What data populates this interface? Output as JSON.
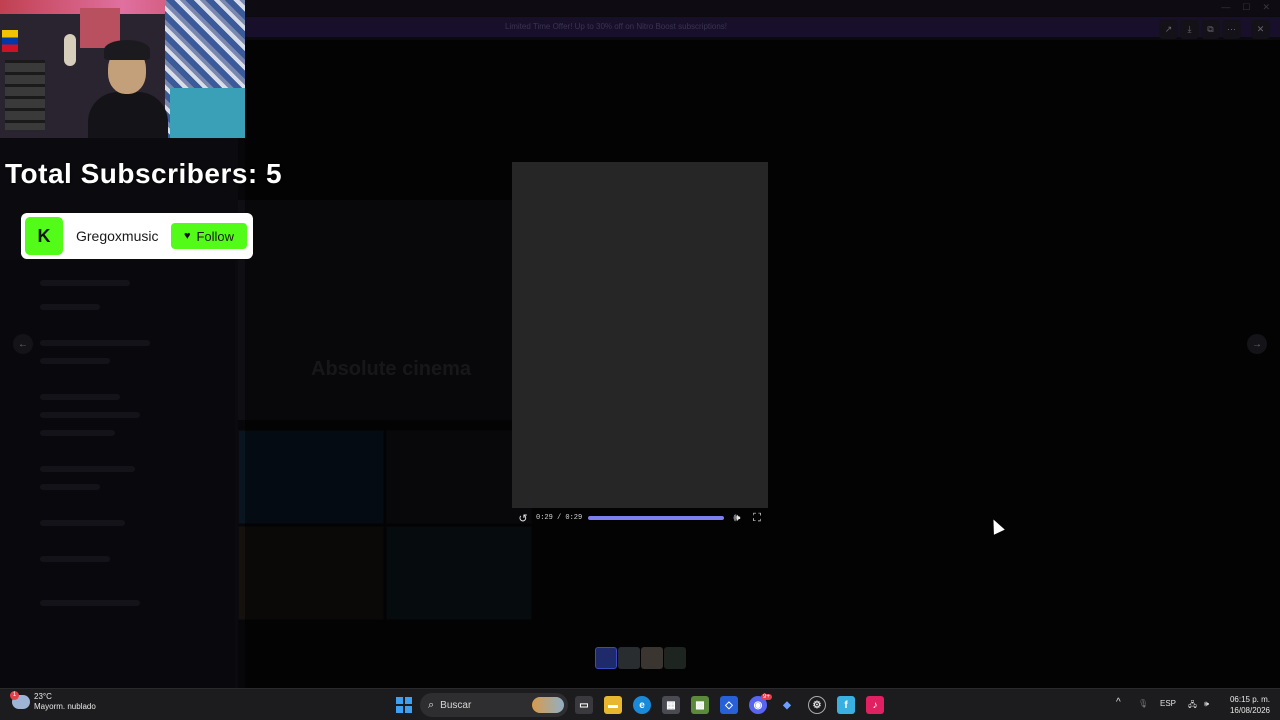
{
  "overlay": {
    "subscribers_label": "Total Subscribers: 5",
    "kick_card": {
      "logo_letter": "K",
      "channel": "Gregoxmusic",
      "follow_label": "Follow"
    }
  },
  "background": {
    "banner_text": "Limited Time Offer! Up to 30% off on Nitro Boost subscriptions!",
    "meme_text": "Absolute cinema"
  },
  "player": {
    "time": "0:29 / 0:29",
    "progress": 1.0,
    "colors": {
      "progress": "#7d7ff0",
      "video_bg": "#262626"
    }
  },
  "icons": {
    "replay": "replay-icon",
    "volume": "volume-icon",
    "fullscreen": "fullscreen-icon",
    "prev": "arrow-left-icon",
    "next": "arrow-right-icon",
    "forward": "forward-icon",
    "download": "download-icon",
    "open": "open-external-icon",
    "more": "more-icon",
    "close": "close-icon"
  },
  "taskbar": {
    "weather_temp": "23°C",
    "weather_desc": "Mayorm. nublado",
    "weather_badge": "1",
    "search_label": "Buscar",
    "language": "ESP",
    "time": "06:15 p. m.",
    "date": "16/08/2026",
    "discord_badge": "9+"
  }
}
